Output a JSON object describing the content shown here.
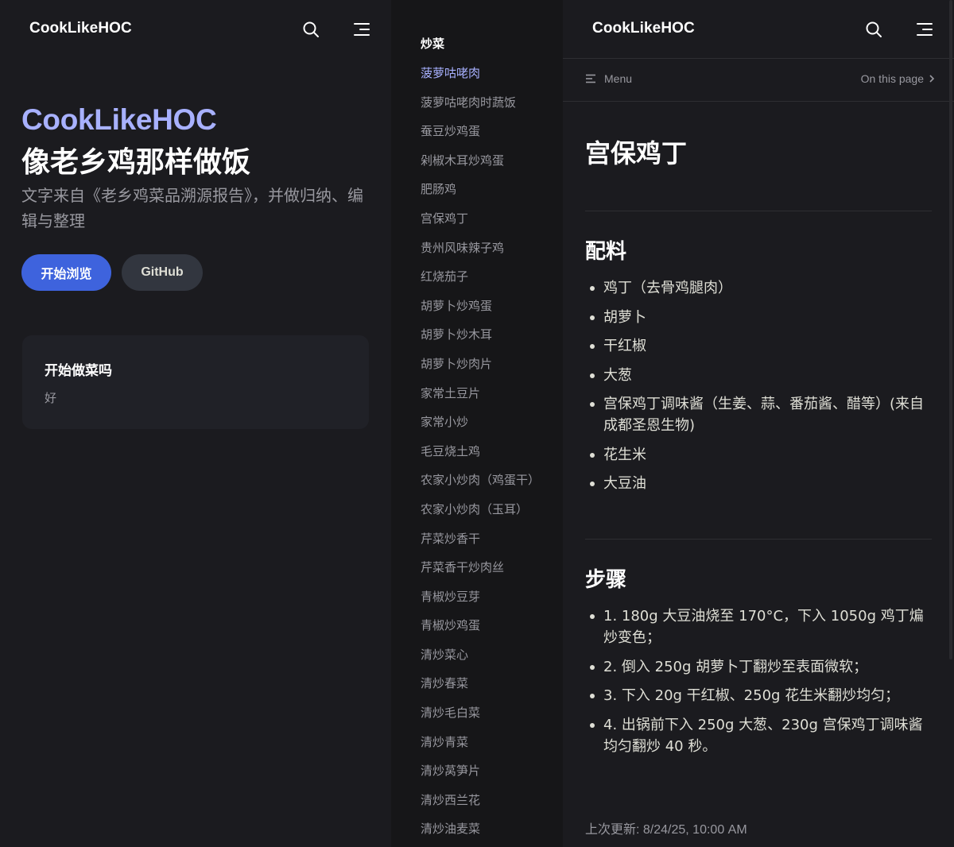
{
  "home": {
    "site_title": "CookLikeHOC",
    "hero_name": "CookLikeHOC",
    "hero_text": "像老乡鸡那样做饭",
    "hero_tagline": "文字来自《老乡鸡菜品溯源报告》，并做归纳、编辑与整理",
    "actions": {
      "primary": "开始浏览",
      "secondary": "GitHub"
    },
    "feature": {
      "title": "开始做菜吗",
      "details": "好"
    }
  },
  "sidebar": {
    "group_title": "炒菜",
    "active_index": 0,
    "items": [
      "菠萝咕咾肉",
      "菠萝咕咾肉时蔬饭",
      "蚕豆炒鸡蛋",
      "剁椒木耳炒鸡蛋",
      "肥肠鸡",
      "宫保鸡丁",
      "贵州风味辣子鸡",
      "红烧茄子",
      "胡萝卜炒鸡蛋",
      "胡萝卜炒木耳",
      "胡萝卜炒肉片",
      "家常土豆片",
      "家常小炒",
      "毛豆烧土鸡",
      "农家小炒肉（鸡蛋干）",
      "农家小炒肉（玉耳）",
      "芹菜炒香干",
      "芹菜香干炒肉丝",
      "青椒炒豆芽",
      "青椒炒鸡蛋",
      "清炒菜心",
      "清炒春菜",
      "清炒毛白菜",
      "清炒青菜",
      "清炒莴笋片",
      "清炒西兰花",
      "清炒油麦菜"
    ]
  },
  "doc": {
    "site_title": "CookLikeHOC",
    "local_nav": {
      "menu_label": "Menu",
      "outline_label": "On this page"
    },
    "title": "宫保鸡丁",
    "ingredients_heading": "配料",
    "ingredients": [
      "鸡丁（去骨鸡腿肉）",
      "胡萝卜",
      "干红椒",
      "大葱",
      "宫保鸡丁调味酱（生姜、蒜、番茄酱、醋等）(来自成都圣恩生物)",
      "花生米",
      "大豆油"
    ],
    "steps_heading": "步骤",
    "steps": [
      "1. 180g 大豆油烧至 170°C，下入 1050g 鸡丁煸炒变色；",
      "2. 倒入 250g 胡萝卜丁翻炒至表面微软；",
      "3. 下入 20g 干红椒、250g 花生米翻炒均匀；",
      "4. 出锅前下入 250g 大葱、230g 宫保鸡丁调味酱均匀翻炒 40 秒。"
    ],
    "last_updated_label": "上次更新:",
    "last_updated_time": "8/24/25, 10:00 AM"
  },
  "colors": {
    "background": "#1b1b1f",
    "sidebar_background": "#161618",
    "brand": "#3e63dd",
    "accent_text": "#a8b1ff",
    "muted_text": "#98989f"
  },
  "icons": [
    "search-icon",
    "menu-icon",
    "list-icon",
    "chevron-right-icon"
  ]
}
